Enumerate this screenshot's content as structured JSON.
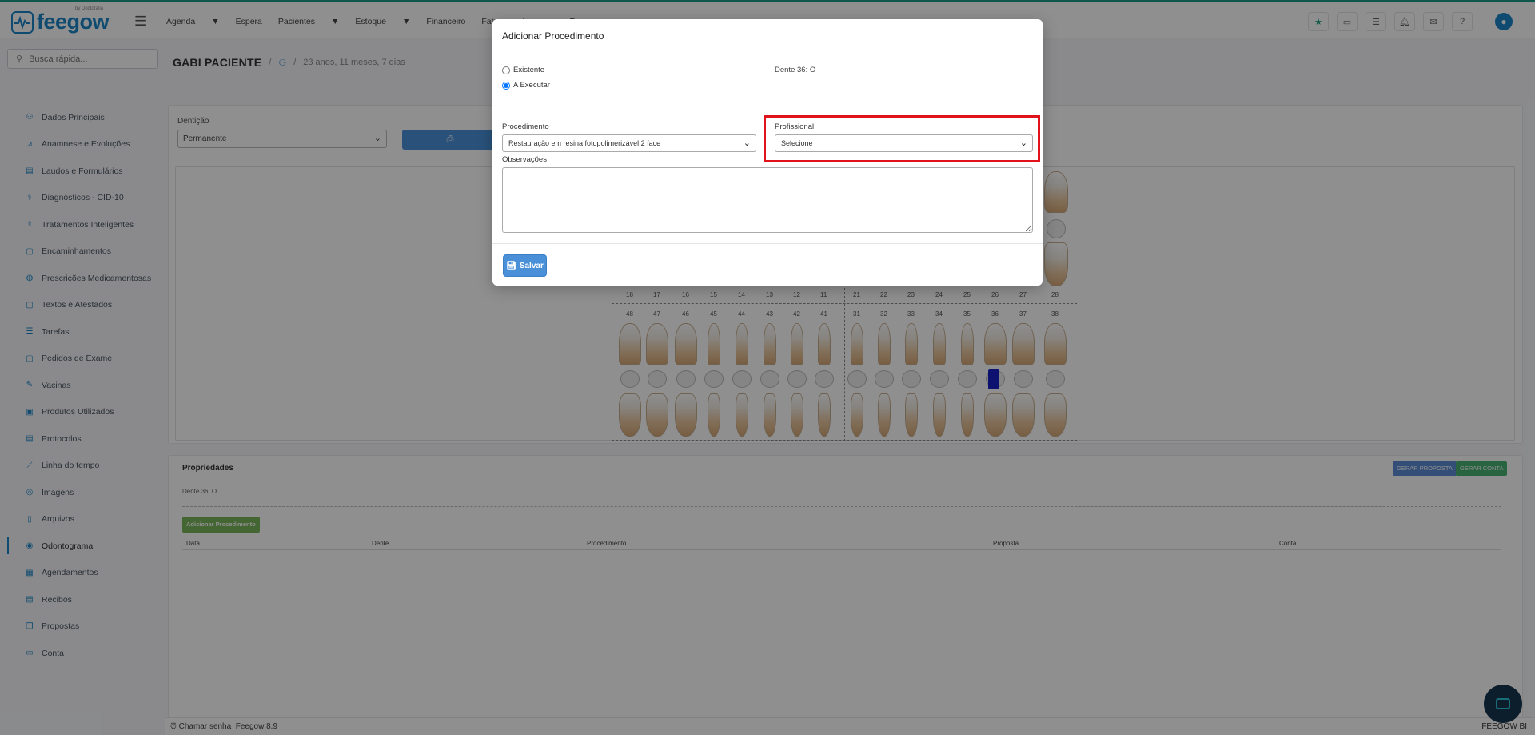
{
  "app": {
    "logo_text": "feegow",
    "logo_sub": "by Doctoralia"
  },
  "nav": {
    "items": [
      "Agenda",
      "Espera",
      "Pacientes",
      "Estoque",
      "Financeiro",
      "Faturamento",
      "Re"
    ],
    "dropdown_flags": [
      true,
      false,
      true,
      true,
      false,
      true,
      false
    ]
  },
  "search": {
    "placeholder": "Busca rápida..."
  },
  "sidebar": {
    "items": [
      {
        "label": "Dados Principais",
        "icon": "user-icon"
      },
      {
        "label": "Anamnese e Evoluções",
        "icon": "chart-line-icon"
      },
      {
        "label": "Laudos e Formulários",
        "icon": "clipboard-icon"
      },
      {
        "label": "Diagnósticos - CID-10",
        "icon": "stethoscope-icon"
      },
      {
        "label": "Tratamentos Inteligentes",
        "icon": "stethoscope-icon"
      },
      {
        "label": "Encaminhamentos",
        "icon": "document-icon"
      },
      {
        "label": "Prescrições Medicamentosas",
        "icon": "pills-icon"
      },
      {
        "label": "Textos e Atestados",
        "icon": "document-icon"
      },
      {
        "label": "Tarefas",
        "icon": "list-icon"
      },
      {
        "label": "Pedidos de Exame",
        "icon": "document-icon"
      },
      {
        "label": "Vacinas",
        "icon": "syringe-icon"
      },
      {
        "label": "Produtos Utilizados",
        "icon": "box-icon"
      },
      {
        "label": "Protocolos",
        "icon": "clipboard-icon"
      },
      {
        "label": "Linha do tempo",
        "icon": "timeline-icon"
      },
      {
        "label": "Imagens",
        "icon": "camera-icon"
      },
      {
        "label": "Arquivos",
        "icon": "file-icon"
      },
      {
        "label": "Odontograma",
        "icon": "tooth-icon",
        "active": true
      },
      {
        "label": "Agendamentos",
        "icon": "calendar-icon"
      },
      {
        "label": "Recibos",
        "icon": "receipt-icon"
      },
      {
        "label": "Propostas",
        "icon": "copy-icon"
      },
      {
        "label": "Conta",
        "icon": "money-icon"
      }
    ]
  },
  "patient": {
    "name": "GABI PACIENTE",
    "age": "23 anos, 11 meses, 7 dias"
  },
  "odontogram": {
    "dentition_label": "Dentição",
    "dentition_value": "Permanente",
    "upper_numbers": [
      "18",
      "17",
      "16",
      "15",
      "14",
      "13",
      "12",
      "11",
      "21",
      "22",
      "23",
      "24",
      "25",
      "26",
      "27",
      "28"
    ],
    "lower_numbers": [
      "48",
      "47",
      "46",
      "45",
      "44",
      "43",
      "42",
      "41",
      "31",
      "32",
      "33",
      "34",
      "35",
      "36",
      "37",
      "38"
    ],
    "marked_tooth": "36",
    "mark_color": "#1820c9"
  },
  "properties": {
    "title": "Propriedades",
    "dente_note": "Dente 36: O",
    "gerar_proposta": "GERAR PROPOSTA",
    "gerar_conta": "GERAR CONTA",
    "add_procedure": "Adicionar Procedimento",
    "columns": [
      "Data",
      "Dente",
      "Procedimento",
      "Proposta",
      "Conta"
    ]
  },
  "footer": {
    "chamar_senha": "Chamar senha",
    "version": "Feegow 8.9",
    "right": "FEEGOW BI"
  },
  "modal": {
    "title": "Adicionar Procedimento",
    "radio_existente": "Existente",
    "radio_executar": "A Executar",
    "selected_radio": "A Executar",
    "dente_label": "Dente 36: O",
    "procedimento_label": "Procedimento",
    "procedimento_value": "Restauração em resina fotopolimerizável 2 face",
    "profissional_label": "Profissional",
    "profissional_value": "Selecione",
    "observacoes_label": "Observações",
    "observacoes_value": "",
    "save_label": "Salvar"
  },
  "colors": {
    "brand": "#1b86c9",
    "highlight": "#e0121a",
    "save_button": "#4a90d9"
  }
}
